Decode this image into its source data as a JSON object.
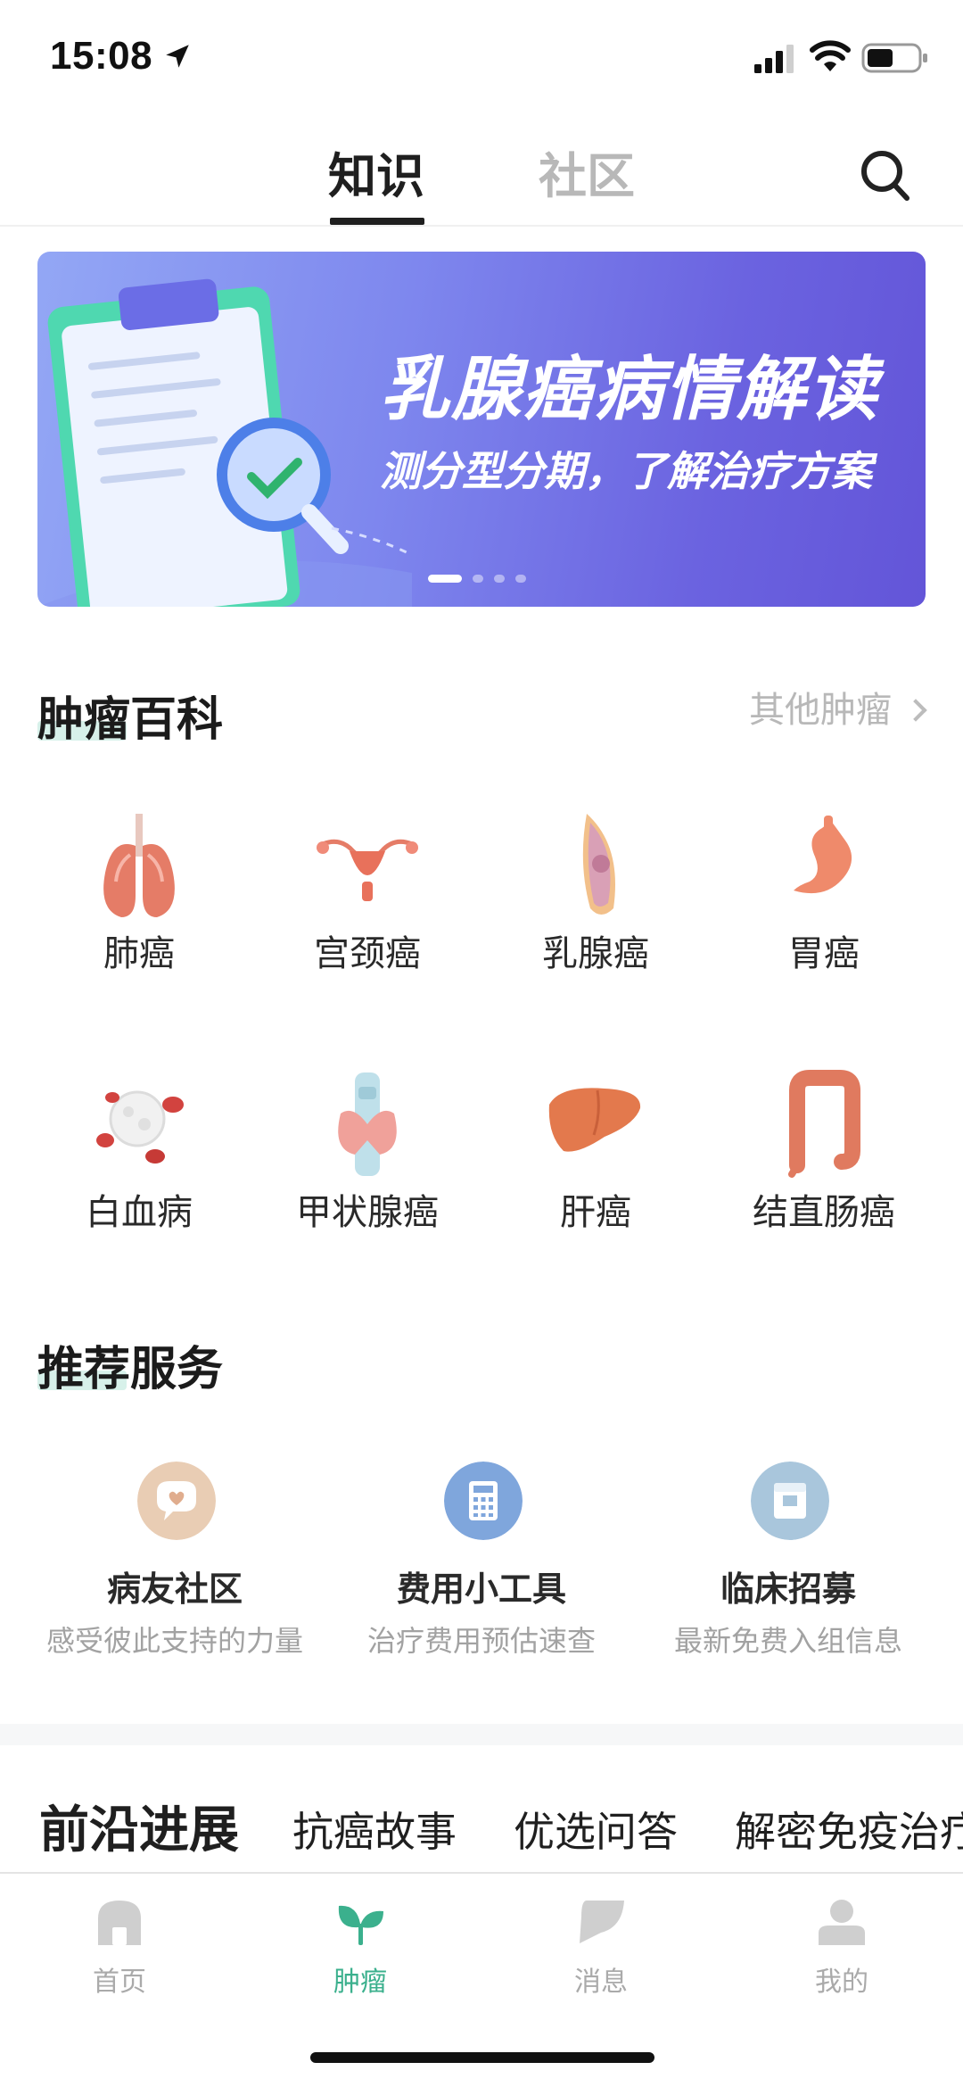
{
  "status_bar": {
    "time": "15:08"
  },
  "top_tabs": {
    "active": "知识",
    "inactive": "社区"
  },
  "banner": {
    "title": "乳腺癌病情解读",
    "subtitle": "测分型分期，了解治疗方案",
    "page_count": 4,
    "active_page": 1
  },
  "encyclopedia": {
    "title": "肿瘤百科",
    "more_label": "其他肿瘤",
    "items": [
      {
        "label": "肺癌",
        "icon": "lungs-icon"
      },
      {
        "label": "宫颈癌",
        "icon": "uterus-icon"
      },
      {
        "label": "乳腺癌",
        "icon": "breast-icon"
      },
      {
        "label": "胃癌",
        "icon": "stomach-icon"
      },
      {
        "label": "白血病",
        "icon": "blood-cell-icon"
      },
      {
        "label": "甲状腺癌",
        "icon": "thyroid-icon"
      },
      {
        "label": "肝癌",
        "icon": "liver-icon"
      },
      {
        "label": "结直肠癌",
        "icon": "colon-icon"
      }
    ]
  },
  "services": {
    "title": "推荐服务",
    "items": [
      {
        "title": "病友社区",
        "desc": "感受彼此支持的力量",
        "icon": "chat-heart-icon",
        "color": "#e9cdb4"
      },
      {
        "title": "费用小工具",
        "desc": "治疗费用预估速查",
        "icon": "calculator-icon",
        "color": "#7fa6dc"
      },
      {
        "title": "临床招募",
        "desc": "最新免费入组信息",
        "icon": "clipboard-icon",
        "color": "#a9c6dc"
      }
    ]
  },
  "feed_tabs": [
    "前沿进展",
    "抗癌故事",
    "优选问答",
    "解密免疫治疗"
  ],
  "bottom_nav": {
    "items": [
      {
        "label": "首页",
        "icon": "home-icon",
        "active": false
      },
      {
        "label": "肿瘤",
        "icon": "sprout-icon",
        "active": true
      },
      {
        "label": "消息",
        "icon": "message-icon",
        "active": false
      },
      {
        "label": "我的",
        "icon": "profile-icon",
        "active": false
      }
    ]
  },
  "colors": {
    "accent_green": "#3bb08d",
    "section_mark": "#d7f1ea",
    "banner_start": "#93a7f5",
    "banner_end": "#6355d8"
  }
}
